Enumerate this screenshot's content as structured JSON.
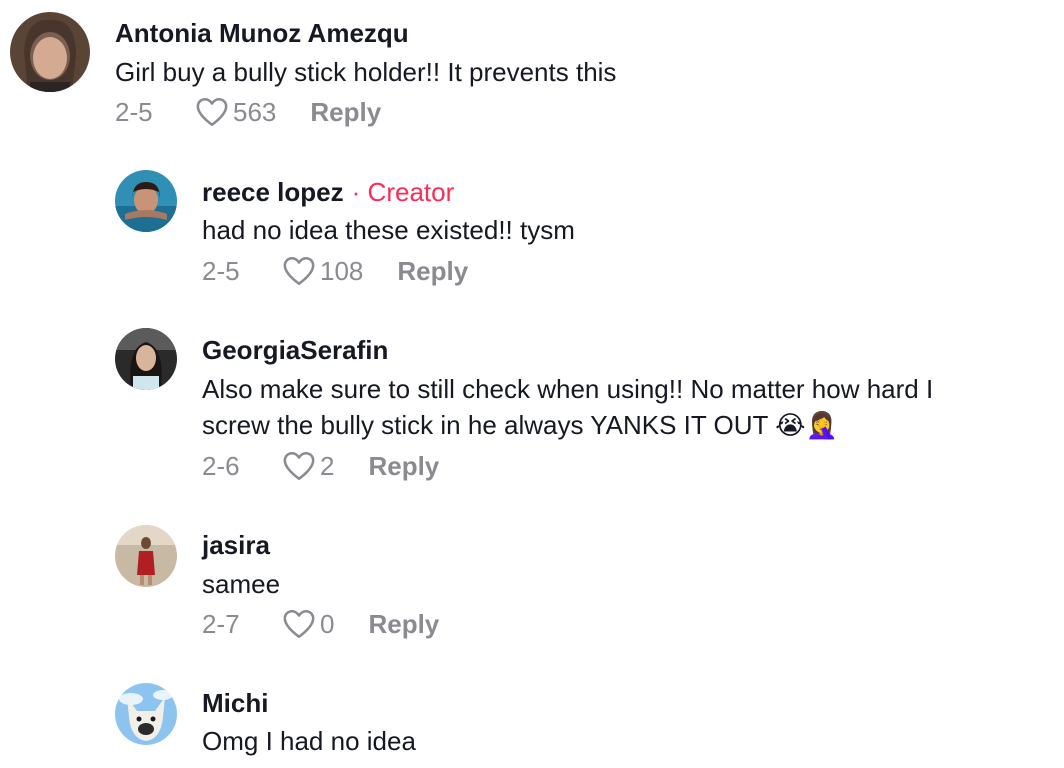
{
  "comments": [
    {
      "username": "Antonia Munoz Amezqu",
      "text": [
        "Girl buy a bully stick holder!! It prevents this"
      ],
      "date": "2-5",
      "likes": "563",
      "reply_label": "Reply"
    },
    {
      "username": "reece lopez",
      "creator_separator": "·",
      "creator_label": "Creator",
      "text": [
        "had no idea these existed!! tysm"
      ],
      "date": "2-5",
      "likes": "108",
      "reply_label": "Reply"
    },
    {
      "username": "GeorgiaSerafin",
      "text": [
        "Also make sure to still check when using!! No matter how hard I",
        "screw the bully stick in he always YANKS IT OUT 😭🤦‍♀️"
      ],
      "date": "2-6",
      "likes": "2",
      "reply_label": "Reply"
    },
    {
      "username": "jasira",
      "text": [
        "samee"
      ],
      "date": "2-7",
      "likes": "0",
      "reply_label": "Reply"
    },
    {
      "username": "Michi",
      "text": [
        "Omg I had no idea"
      ]
    }
  ],
  "colors": {
    "primary_text": "#161823",
    "secondary_text": "#8a8b91",
    "creator_accent": "#fe2c55"
  }
}
